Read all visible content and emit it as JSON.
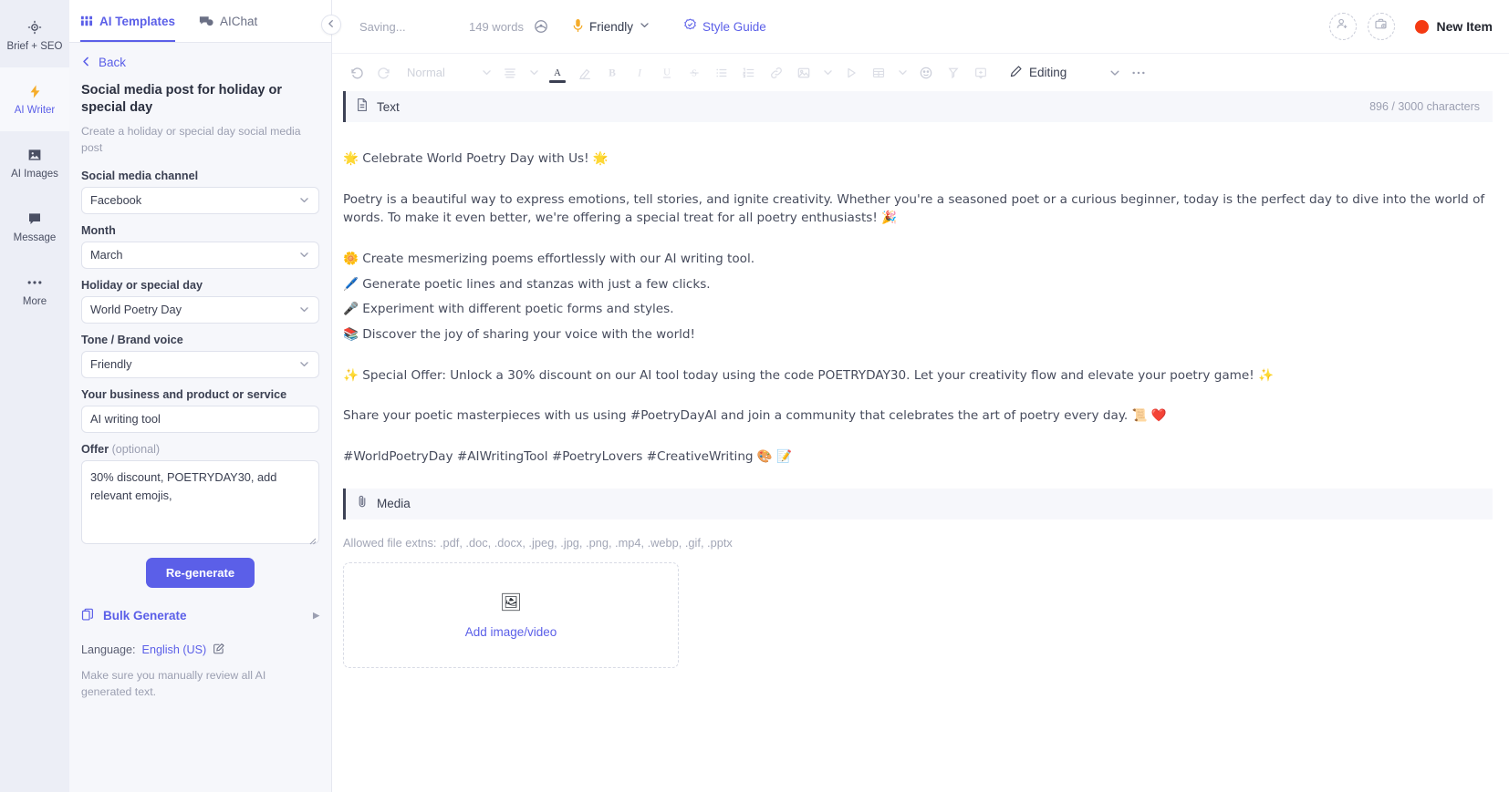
{
  "rail": {
    "items": [
      {
        "label": "Brief + SEO",
        "icon": "target-icon",
        "active": false
      },
      {
        "label": "AI Writer",
        "icon": "lightning-bolt-icon",
        "active": true
      },
      {
        "label": "AI Images",
        "icon": "image-icon",
        "active": false
      },
      {
        "label": "Message",
        "icon": "chat-bubble-icon",
        "active": false
      },
      {
        "label": "More",
        "icon": "ellipsis-icon",
        "active": false
      }
    ]
  },
  "panel": {
    "tabs": [
      {
        "label": "AI Templates",
        "icon": "grid-icon",
        "active": true
      },
      {
        "label": "AIChat",
        "icon": "chat-bubbles-icon",
        "active": false
      }
    ],
    "back_label": "Back",
    "template_title": "Social media post for holiday or special day",
    "template_description": "Create a holiday or special day social media post",
    "fields": [
      {
        "label": "Social media channel",
        "type": "select",
        "value": "Facebook"
      },
      {
        "label": "Month",
        "type": "select",
        "value": "March"
      },
      {
        "label": "Holiday or special day",
        "type": "select",
        "value": "World Poetry Day"
      },
      {
        "label": "Tone / Brand voice",
        "type": "select",
        "value": "Friendly"
      },
      {
        "label": "Your business and product or service",
        "type": "text",
        "value": "AI writing tool"
      }
    ],
    "offer": {
      "label": "Offer",
      "optional_suffix": "(optional)",
      "value": "30% discount, POETRYDAY30, add relevant emojis,"
    },
    "regenerate_label": "Re-generate",
    "bulk_generate_label": "Bulk Generate",
    "language_prefix": "Language:",
    "language_value": "English (US)",
    "disclaimer": "Make sure you manually review all AI generated text."
  },
  "topbar": {
    "saving_status": "Saving...",
    "word_count": "149 words",
    "tone_label": "Friendly",
    "style_guide_label": "Style Guide",
    "new_item_label": "New Item",
    "new_item_dot_color": "#f43a12",
    "accent_color": "#5b5fe8"
  },
  "toolbar": {
    "paragraph_style": "Normal",
    "mode_label": "Editing",
    "buttons": [
      "undo-icon",
      "redo-icon",
      "align-icon",
      "text-color-icon",
      "highlight-icon",
      "bold-icon",
      "italic-icon",
      "underline-icon",
      "strikethrough-icon",
      "bullet-list-icon",
      "numbered-list-icon",
      "link-icon",
      "image-icon",
      "play-icon",
      "table-icon",
      "emoji-icon",
      "clear-format-icon",
      "comment-icon"
    ]
  },
  "text_section": {
    "title": "Text",
    "char_count": "896 / 3000 characters",
    "paragraphs": [
      "🌟 Celebrate World Poetry Day with Us! 🌟",
      "Poetry is a beautiful way to express emotions, tell stories, and ignite creativity. Whether you're a seasoned poet or a curious beginner, today is the perfect day to dive into the world of words. To make it even better, we're offering a special treat for all poetry enthusiasts! 🎉"
    ],
    "bullets": [
      "🌼 Create mesmerizing poems effortlessly with our AI writing tool.",
      "🖊️ Generate poetic lines and stanzas with just a few clicks.",
      "🎤 Experiment with different poetic forms and styles.",
      "📚 Discover the joy of sharing your voice with the world!"
    ],
    "paragraphs_after": [
      "✨ Special Offer: Unlock a 30% discount on our AI tool today using the code POETRYDAY30. Let your creativity flow and elevate your poetry game! ✨",
      "Share your poetic masterpieces with us using #PoetryDayAI and join a community that celebrates the art of poetry every day. 📜 ❤️",
      "#WorldPoetryDay #AIWritingTool #PoetryLovers #CreativeWriting 🎨 📝"
    ]
  },
  "media_section": {
    "title": "Media",
    "allowed_note": "Allowed file extns: .pdf, .doc, .docx, .jpeg, .jpg, .png, .mp4, .webp, .gif, .pptx",
    "dropzone_label": "Add image/video",
    "dropzone_icon": "🖼"
  }
}
